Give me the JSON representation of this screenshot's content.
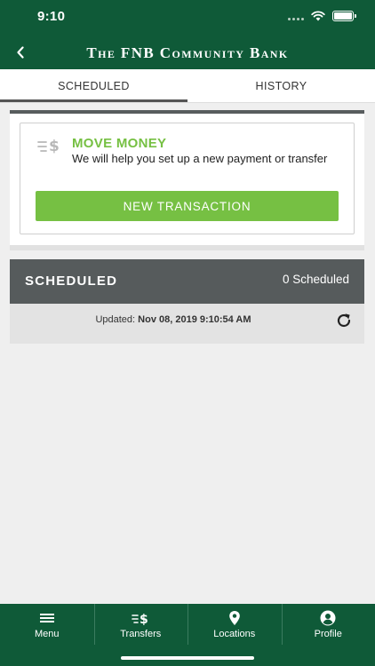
{
  "status_bar": {
    "time": "9:10"
  },
  "header": {
    "title": "The FNB Community Bank"
  },
  "tabs": [
    {
      "label": "SCHEDULED",
      "active": true
    },
    {
      "label": "HISTORY",
      "active": false
    }
  ],
  "move_money": {
    "icon": "transfer-dollar-icon",
    "title": "MOVE MONEY",
    "description": "We will help you set up a new payment or transfer",
    "button_label": "NEW TRANSACTION"
  },
  "scheduled": {
    "title": "SCHEDULED",
    "count_text": "0 Scheduled",
    "updated_label": "Updated:",
    "updated_value": "Nov 08, 2019 9:10:54 AM"
  },
  "bottom_nav": [
    {
      "icon": "menu-icon",
      "label": "Menu"
    },
    {
      "icon": "transfers-icon",
      "label": "Transfers"
    },
    {
      "icon": "location-pin-icon",
      "label": "Locations"
    },
    {
      "icon": "profile-icon",
      "label": "Profile"
    }
  ],
  "colors": {
    "brand_green": "#0f5a38",
    "accent_green": "#76c043",
    "section_gray": "#565b5c",
    "background": "#efefef"
  }
}
